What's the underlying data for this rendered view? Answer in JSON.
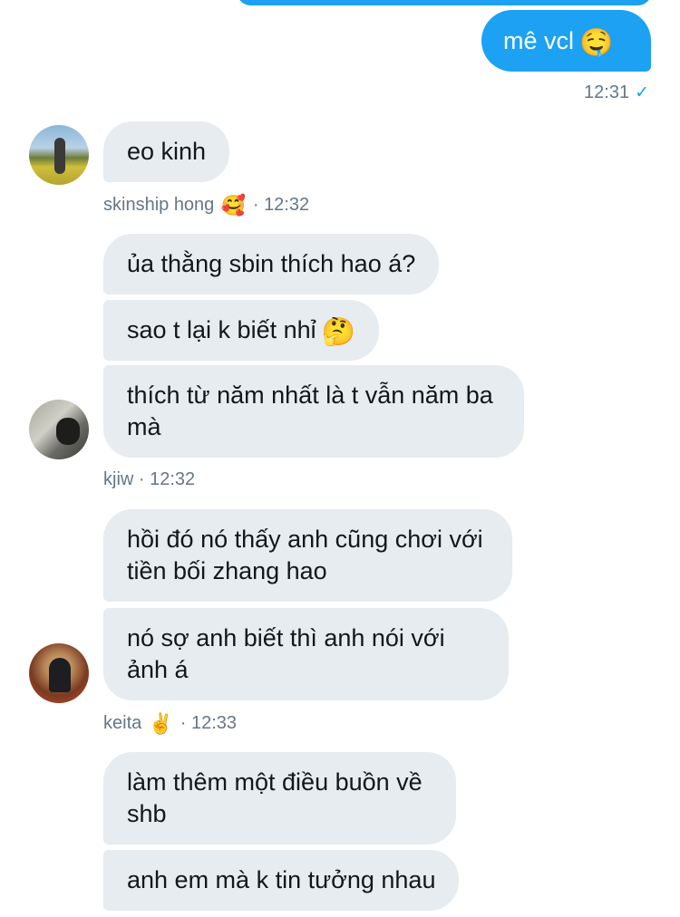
{
  "outgoing": {
    "text": "mê vcl",
    "emoji": "🤤",
    "time": "12:31",
    "status_icon": "✓"
  },
  "groups": [
    {
      "sender": "skinship hong",
      "sender_emoji": "🥰",
      "time": "12:32",
      "messages": [
        "eo kinh"
      ]
    },
    {
      "sender": "kjiw",
      "time": "12:32",
      "messages": [
        "ủa thằng sbin thích hao á?",
        "sao t lại k biết nhỉ",
        "thích từ năm nhất là t vẫn năm ba mà"
      ],
      "emoji_after_2": "🤔"
    },
    {
      "sender": "keita",
      "sender_emoji": "✌️",
      "time": "12:33",
      "messages": [
        "hồi đó nó thấy anh cũng chơi với tiền bối zhang hao",
        "nó sợ anh biết thì anh nói với ảnh á"
      ]
    },
    {
      "messages": [
        "làm thêm một điều buồn về shb",
        "anh em mà k tin tưởng nhau"
      ]
    }
  ],
  "separator": " · ",
  "colors": {
    "accent": "#1da1f2",
    "incoming_bubble": "#e6ecf0",
    "meta_text": "#657786"
  }
}
